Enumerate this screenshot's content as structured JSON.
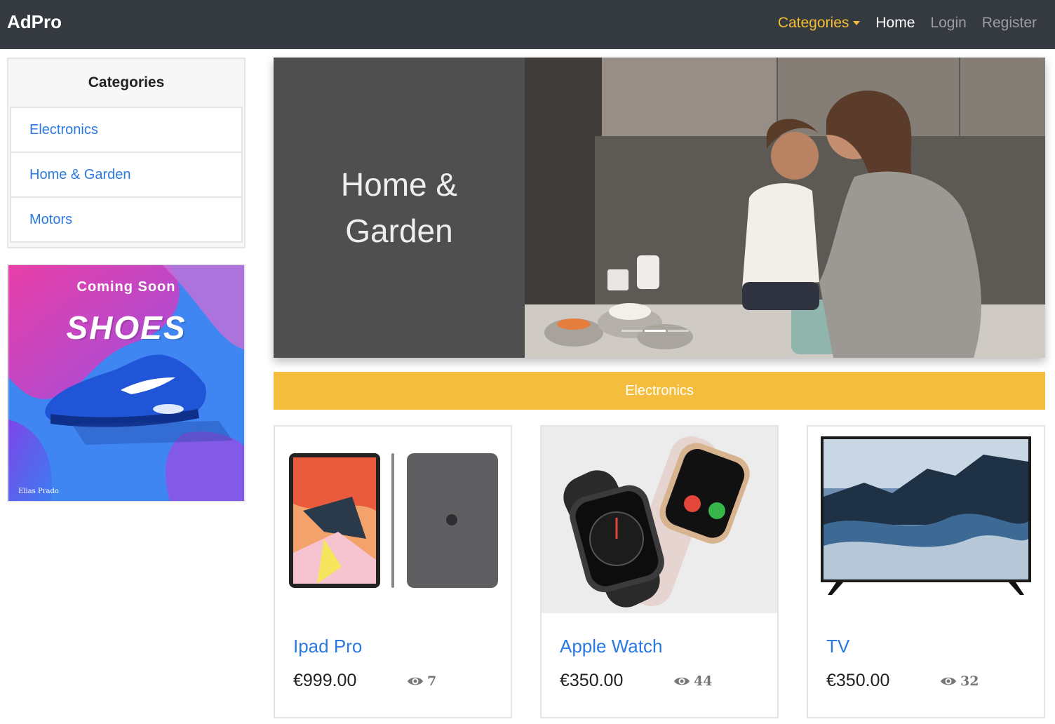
{
  "navbar": {
    "brand": "AdPro",
    "links": {
      "categories": "Categories",
      "home": "Home",
      "login": "Login",
      "register": "Register"
    }
  },
  "sidebar": {
    "heading": "Categories",
    "items": [
      {
        "label": "Electronics"
      },
      {
        "label": "Home & Garden"
      },
      {
        "label": "Motors"
      }
    ]
  },
  "ad": {
    "subtitle": "Coming Soon",
    "title": "SHOES",
    "credit": "Elias Prado"
  },
  "carousel": {
    "caption": "Home & Garden",
    "slide_count": 3,
    "active_slide": 2
  },
  "section": {
    "title": "Electronics"
  },
  "products": [
    {
      "name": "Ipad Pro",
      "price": "€999.00",
      "views": "7"
    },
    {
      "name": "Apple Watch",
      "price": "€350.00",
      "views": "44"
    },
    {
      "name": "TV",
      "price": "€350.00",
      "views": "32"
    }
  ],
  "colors": {
    "navbar_bg": "#343a40",
    "accent": "#f4bd3d",
    "link": "#2a7ae2"
  }
}
